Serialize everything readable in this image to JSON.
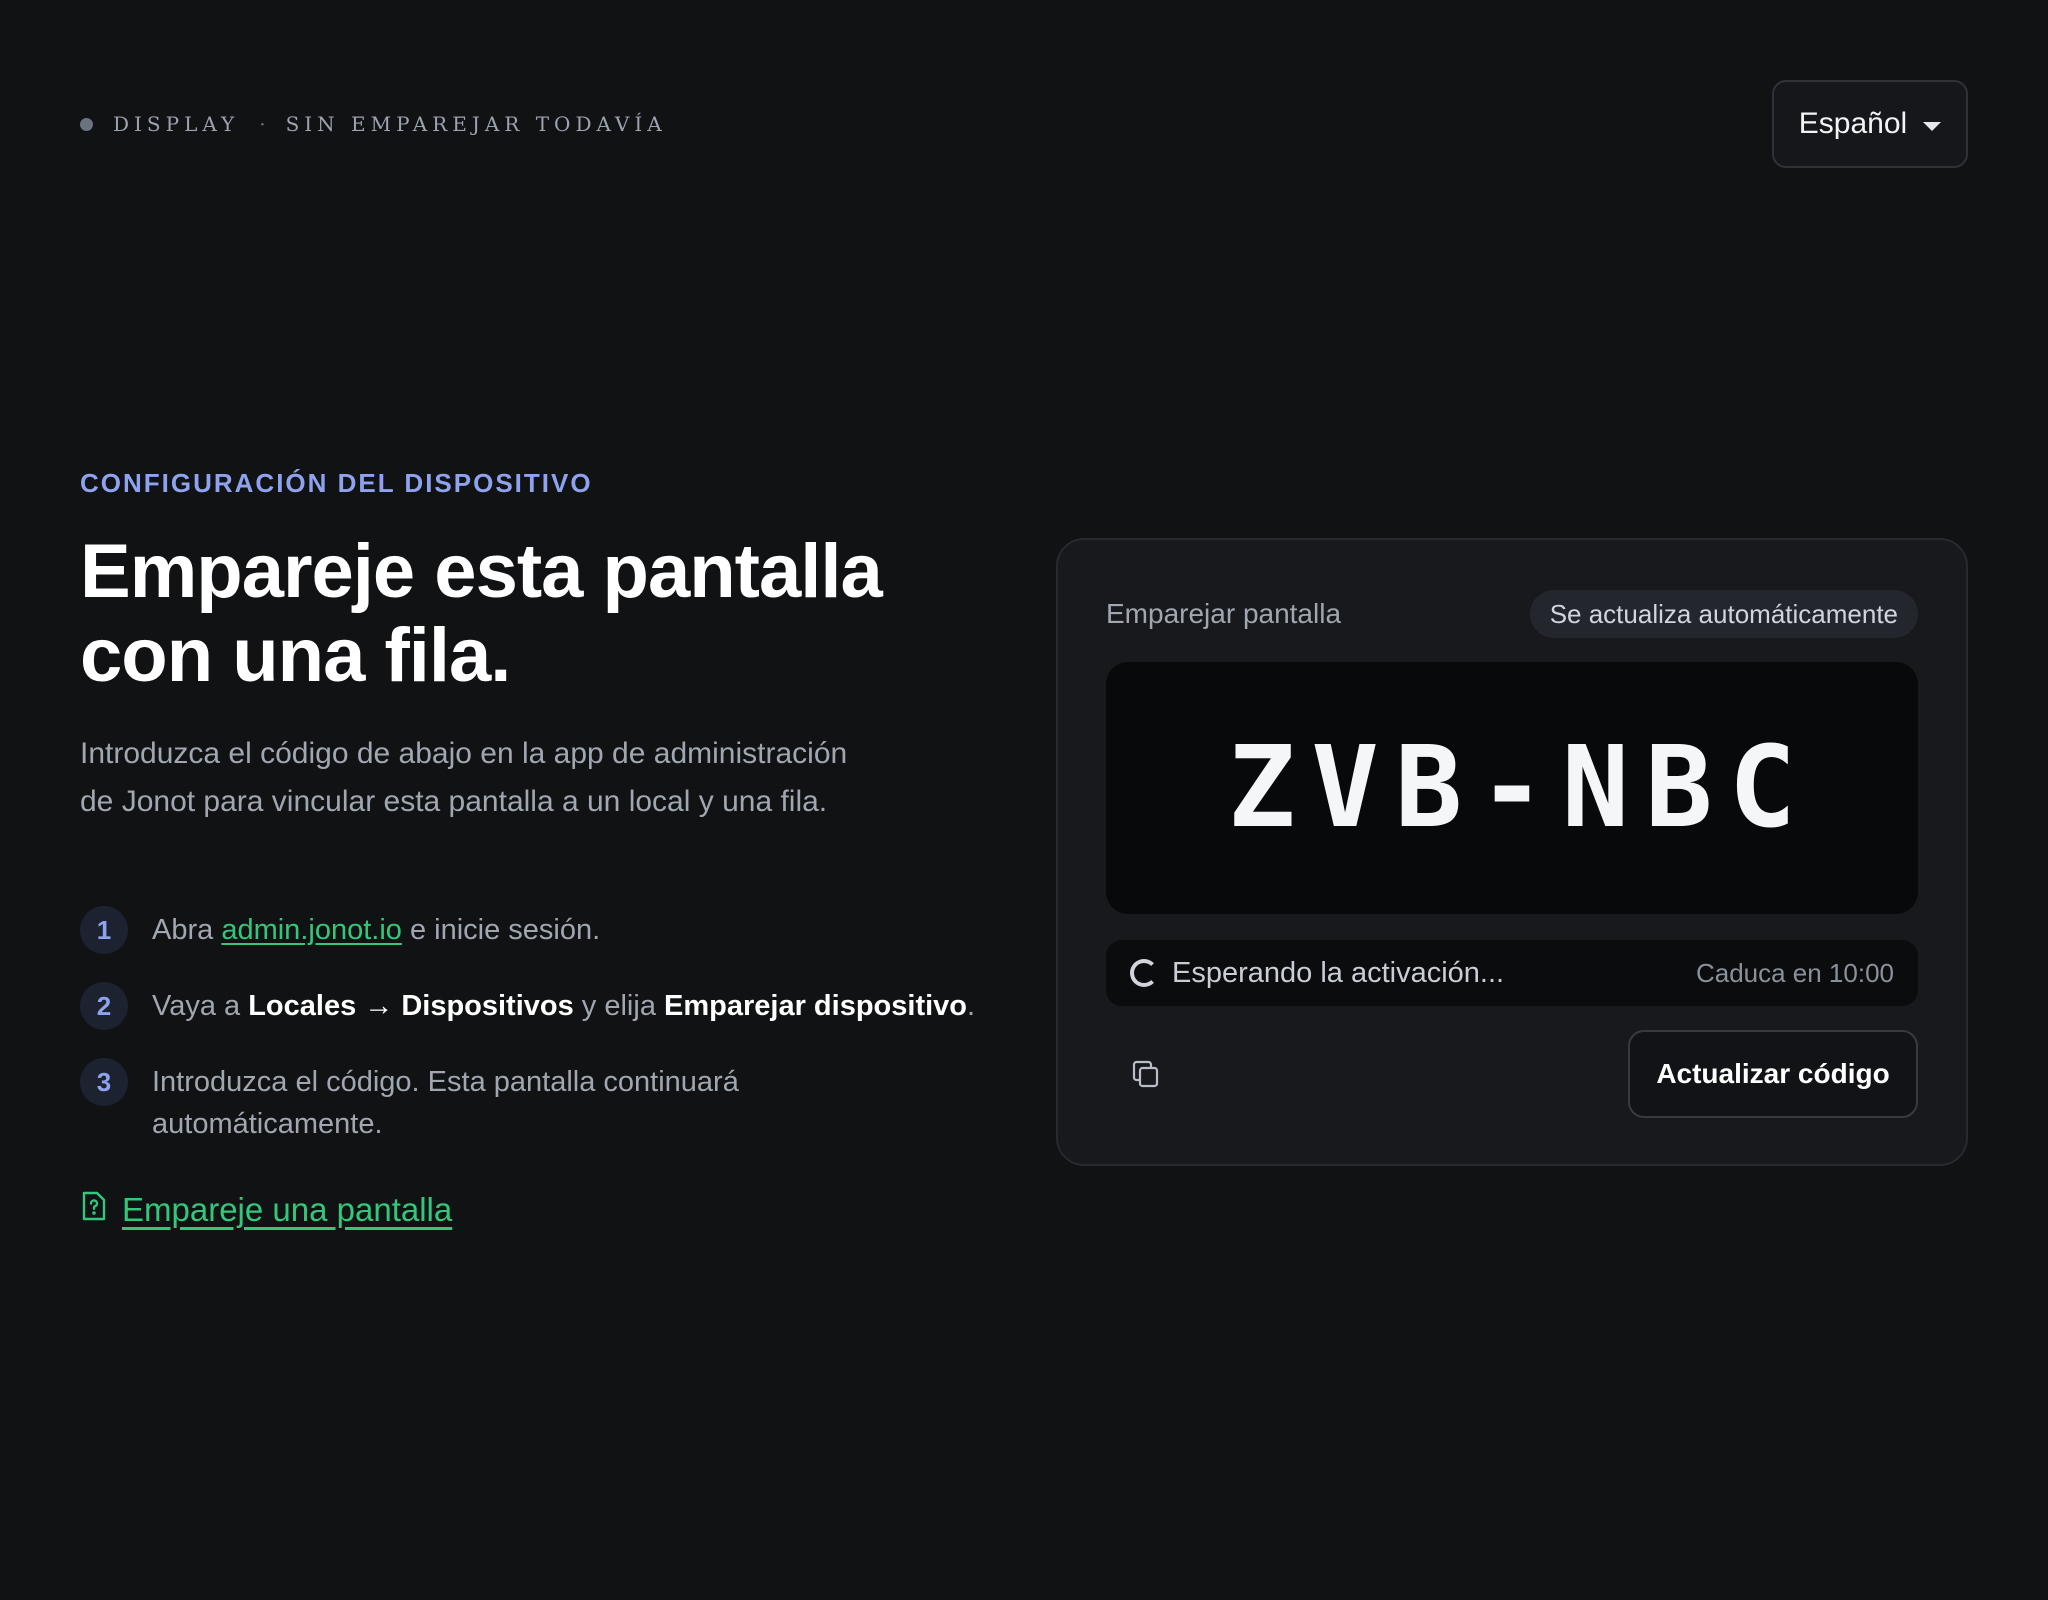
{
  "topbar": {
    "device": "DISPLAY",
    "separator": "·",
    "status": "SIN EMPAREJAR TODAVÍA",
    "language": "Español",
    "icons": {
      "status_dot": "status-dot-icon",
      "caret": "caret-down-icon"
    }
  },
  "main": {
    "eyebrow": "CONFIGURACIÓN DEL DISPOSITIVO",
    "title_line1": "Empareje esta pantalla",
    "title_line2": "con una fila.",
    "intro": "Introduzca el código de abajo en la app de administración de Jonot para vincular esta pantalla a un local y una fila.",
    "steps": [
      {
        "number": "1",
        "prefix": "Abra ",
        "link": "admin.jonot.io",
        "suffix": " e inicie sesión."
      },
      {
        "number": "2",
        "prefix": "Vaya a ",
        "bold1": "Locales → Dispositivos",
        "middle": " y elija ",
        "bold2": "Emparejar dispositivo",
        "suffix": "."
      },
      {
        "number": "3",
        "text": "Introduzca el código. Esta pantalla continuará automáticamente."
      }
    ],
    "help_link": "Empareje una pantalla",
    "help_icon": "help-document-icon"
  },
  "card": {
    "title": "Emparejar pantalla",
    "badge": "Se actualiza automáticamente",
    "code": "ZVB-NBC",
    "waiting": "Esperando la activación...",
    "expires": "Caduca en 10:00",
    "copy_icon": "copy-icon",
    "refresh_label": "Actualizar código"
  },
  "colors": {
    "background": "#101214",
    "accent_blue": "#8ea2ee",
    "accent_green": "#34c77b",
    "card": "#17191d"
  }
}
